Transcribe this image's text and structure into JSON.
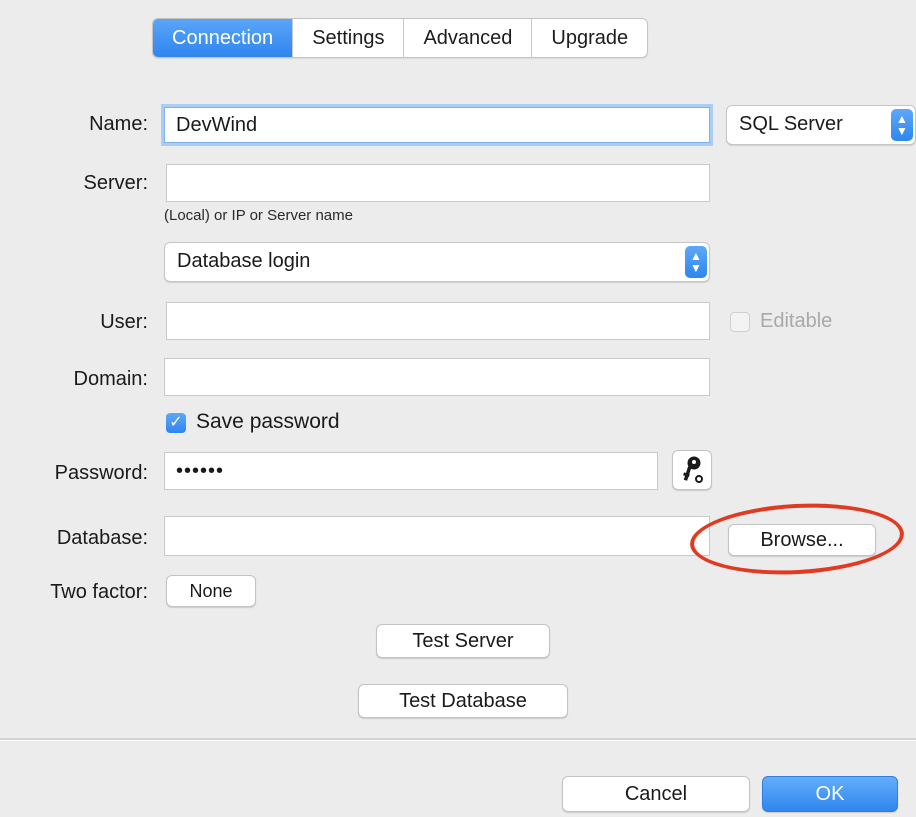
{
  "tabs": [
    {
      "label": "Connection",
      "active": true
    },
    {
      "label": "Settings",
      "active": false
    },
    {
      "label": "Advanced",
      "active": false
    },
    {
      "label": "Upgrade",
      "active": false
    }
  ],
  "form": {
    "name": {
      "label": "Name:",
      "value": "DevWind"
    },
    "server_type": {
      "value": "SQL Server"
    },
    "server": {
      "label": "Server:",
      "value": "",
      "hint": "(Local) or IP or Server name"
    },
    "auth": {
      "value": "Database login"
    },
    "user": {
      "label": "User:",
      "value": ""
    },
    "editable": {
      "label": "Editable",
      "checked": false
    },
    "domain": {
      "label": "Domain:",
      "value": ""
    },
    "save_password": {
      "label": "Save password",
      "checked": true
    },
    "password": {
      "label": "Password:",
      "value": "••••••"
    },
    "database": {
      "label": "Database:",
      "value": "",
      "browse_label": "Browse..."
    },
    "two_factor": {
      "label": "Two factor:",
      "value": "None"
    }
  },
  "actions": {
    "test_server": "Test Server",
    "test_database": "Test Database",
    "cancel": "Cancel",
    "ok": "OK"
  },
  "icons": {
    "key": "key-icon",
    "popup_arrows": "chevron-updown-icon",
    "check": "checkmark-icon"
  },
  "colors": {
    "accent": "#2f86ee",
    "annotation": "#e03b22",
    "window_bg": "#ececec"
  }
}
